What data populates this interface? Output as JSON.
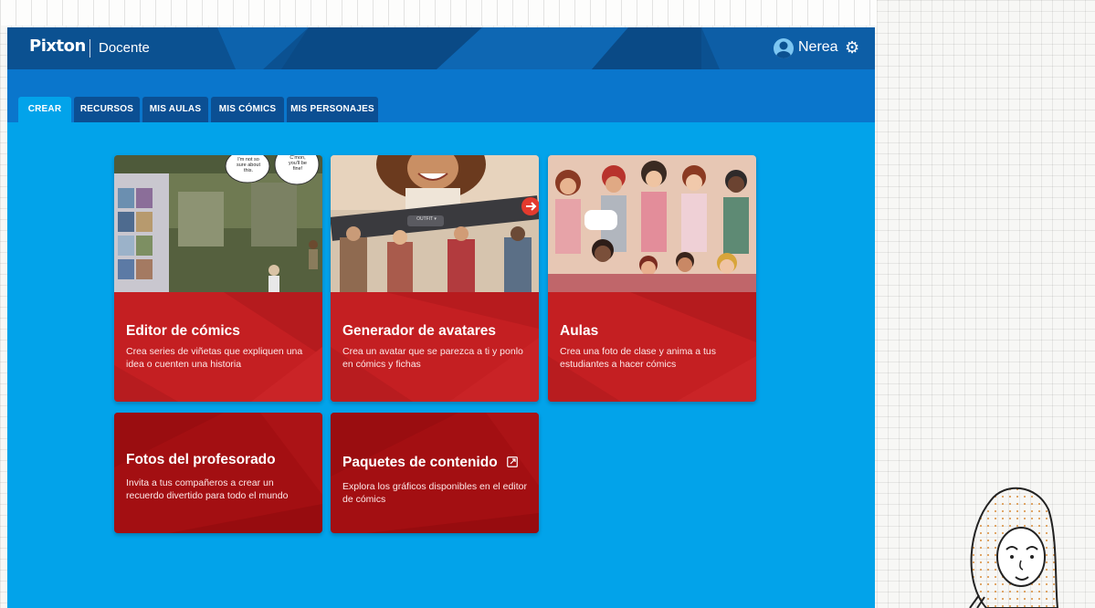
{
  "header": {
    "logo": "Pixton",
    "role": "Docente",
    "user_name": "Nerea",
    "settings_icon": "gear-icon",
    "user_icon": "user-avatar-icon"
  },
  "tabs": [
    {
      "label": "CREAR",
      "active": true
    },
    {
      "label": "RECURSOS",
      "active": false
    },
    {
      "label": "MIS AULAS",
      "active": false
    },
    {
      "label": "MIS CÓMICS",
      "active": false
    },
    {
      "label": "MIS PERSONAJES",
      "active": false
    }
  ],
  "cards": {
    "comic_editor": {
      "title": "Editor de cómics",
      "description": "Crea series de viñetas que expliquen una idea o cuenten una historia",
      "bubble_1": "I'm not so sure about this.",
      "bubble_2": "C'mon, you'll be fine!"
    },
    "avatar_generator": {
      "title": "Generador de avatares",
      "description": "Crea un avatar que se parezca a ti y ponlo en cómics y fichas",
      "button_label": "OUTFIT ▾"
    },
    "classrooms": {
      "title": "Aulas",
      "description": "Crea una foto de clase y anima a tus estudiantes a hacer cómics"
    },
    "staff_photos": {
      "title": "Fotos del profesorado",
      "description": "Invita a tus compañeros a crear un recuerdo divertido para todo el mundo"
    },
    "content_packs": {
      "title": "Paquetes de contenido",
      "description": "Explora los gráficos disponibles en el editor de cómics",
      "icon": "external-link-icon"
    }
  },
  "colors": {
    "app_background": "#02a3ea",
    "header": "#0b5191",
    "tab_bar": "#0a76cc",
    "card_red": "#c41f22",
    "card_dark_red": "#a30f12"
  }
}
